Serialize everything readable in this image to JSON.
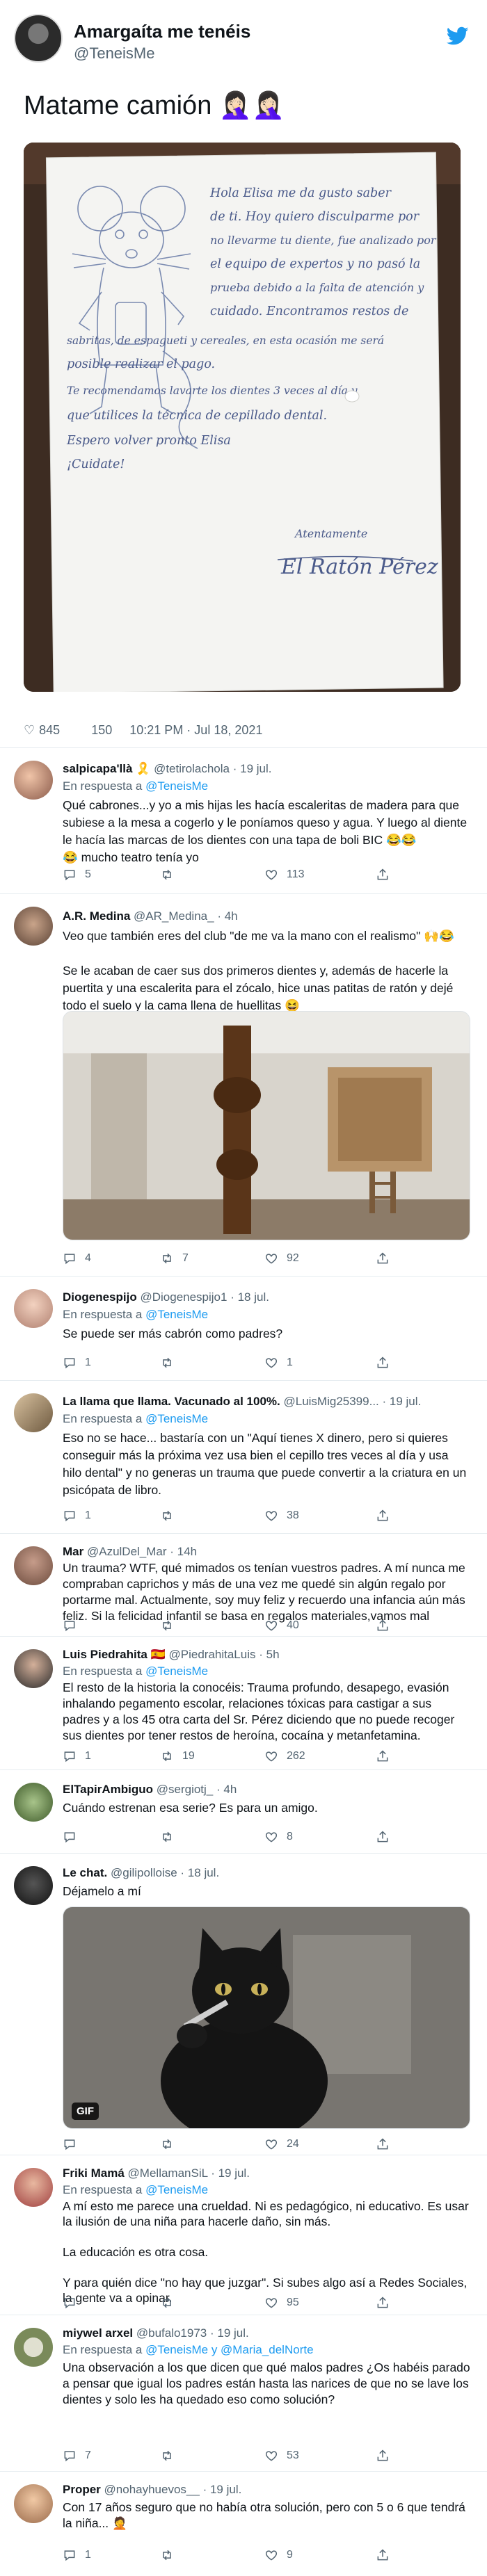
{
  "main_tweet": {
    "name": "Amargaíta me tenéis",
    "handle": "@TeneisMe",
    "text": "Matame camión 🤦🏻‍♀️🤦🏻‍♀️",
    "likes": "845",
    "replies": "150",
    "timestamp": "10:21 PM · Jul 18, 2021",
    "letter": {
      "lines": [
        "Hola Elisa me da gusto saber",
        "de ti. Hoy quiero disculparme por",
        "no llevarme tu diente, fue analizado por",
        "el equipo de expertos y no pasó la",
        "prueba debido a la falta de atención y",
        "cuidado. Encontramos restos de",
        "sabritas, de espagueti y cereales, en esta ocasión me será",
        "posible realizar el pago.",
        "Te recomendamos lavarte los dientes 3 veces al día y",
        "que utilices la técnica de cepillado dental.",
        "Espero volver pronto Elisa",
        "¡Cuidate!"
      ],
      "closing": "Atentamente",
      "signature": "El Ratón Pérez"
    }
  },
  "replies": [
    {
      "name": "salpicapa'llà 🎗️",
      "handle": "@tetirolachola",
      "time": "· 19 jul.",
      "in_reply_prefix": "En respuesta a",
      "in_reply_to": "@TeneisMe",
      "text": "Qué cabrones...y yo a mis hijas les  hacía escaleritas de madera para que subiese a la mesa a cogerlo y le poníamos queso y agua. Y luego al diente le hacía las marcas de los dientes con una tapa de boli BIC 😂😂\n😂 mucho teatro tenía yo",
      "reply_count": "5",
      "retweet_count": "",
      "like_count": "113"
    },
    {
      "name": "A.R. Medina",
      "handle": "@AR_Medina_",
      "time": "· 4h",
      "text": "Veo que también eres del club \"de me va la mano con el realismo\" 🙌😂\n\nSe le acaban de caer sus dos primeros dientes y, además de hacerle la puertita y una escalerita para el zócalo, hice unas patitas de ratón y dejé todo el suelo y la cama llena de huellitas 😆",
      "reply_count": "4",
      "retweet_count": "7",
      "like_count": "92"
    },
    {
      "name": "Diogenespijo",
      "handle": "@Diogenespijo1",
      "time": "· 18 jul.",
      "in_reply_prefix": "En respuesta a",
      "in_reply_to": "@TeneisMe",
      "text": "Se puede ser más cabrón como padres?",
      "reply_count": "1",
      "retweet_count": "",
      "like_count": "1"
    },
    {
      "name": "La llama que llama. Vacunado al 100%.",
      "handle": "@LuisMig25399...",
      "time": "· 19 jul.",
      "in_reply_prefix": "En respuesta a",
      "in_reply_to": "@TeneisMe",
      "text": "Eso no se hace... bastaría con un \"Aquí tienes X dinero, pero si quieres conseguir más la próxima vez usa bien el cepillo tres veces al día y usa hilo dental\" y no generas un trauma que puede convertir a la criatura en un psicópata de libro.",
      "reply_count": "1",
      "retweet_count": "",
      "like_count": "38"
    },
    {
      "name": "Mar",
      "handle": "@AzulDel_Mar",
      "time": "· 14h",
      "text": "Un trauma? WTF, qué mimados os tenían vuestros padres. A mí nunca me compraban caprichos y más de una vez me quedé sin algún regalo por portarme mal. Actualmente, soy muy feliz y recuerdo una infancia aún más feliz. Si la felicidad infantil se basa en regalos materiales,vamos mal",
      "reply_count": "",
      "retweet_count": "",
      "like_count": "40"
    },
    {
      "name": "Luis Piedrahita 🇪🇸",
      "handle": "@PiedrahitaLuis",
      "time": "· 5h",
      "in_reply_prefix": "En respuesta a",
      "in_reply_to": "@TeneisMe",
      "text": "El resto de la historia la conocéis: Trauma profundo, desapego, evasión inhalando pegamento escolar, relaciones tóxicas para castigar a sus padres y a los 45 otra carta del Sr. Pérez diciendo que no puede recoger sus dientes por tener restos de heroína, cocaína y metanfetamina.",
      "reply_count": "1",
      "retweet_count": "19",
      "like_count": "262"
    },
    {
      "name": "ElTapirAmbiguo",
      "handle": "@sergiotj_",
      "time": "· 4h",
      "text": "Cuándo estrenan esa serie? Es para un amigo.",
      "reply_count": "",
      "retweet_count": "",
      "like_count": "8"
    },
    {
      "name": "Le chat.",
      "handle": "@gilipolloise",
      "time": "· 18 jul.",
      "text": "Déjamelo a mí",
      "gif_label": "GIF",
      "reply_count": "",
      "retweet_count": "",
      "like_count": "24"
    },
    {
      "name": "Friki Mamá",
      "handle": "@MellamanSiL",
      "time": "· 19 jul.",
      "in_reply_prefix": "En respuesta a",
      "in_reply_to": "@TeneisMe",
      "text": "A mí esto me parece una crueldad. Ni es pedagógico, ni educativo. Es usar la ilusión de una niña para hacerle daño, sin más.\n\nLa educación es otra cosa.\n\nY para quién dice \"no hay que juzgar\". Si subes algo así a Redes Sociales, la gente va a opinar.",
      "reply_count": "",
      "retweet_count": "",
      "like_count": "95"
    },
    {
      "name": "miywel arxel",
      "handle": "@bufalo1973",
      "time": "· 19 jul.",
      "in_reply_prefix": "En respuesta a",
      "in_reply_to": "@TeneisMe y @Maria_delNorte",
      "text": "Una observación a los que dicen que qué malos padres ¿Os habéis parado a pensar que igual los padres están hasta las narices de que no se lave los dientes y solo les ha quedado eso como solución?",
      "reply_count": "7",
      "retweet_count": "",
      "like_count": "53"
    },
    {
      "name": "Proper",
      "handle": "@nohayhuevos__",
      "time": "· 19 jul.",
      "text": "Con 17 años seguro que no había otra solución, pero con 5 o 6 que tendrá la niña... 🤦",
      "reply_count": "1",
      "retweet_count": "",
      "like_count": "9"
    }
  ]
}
